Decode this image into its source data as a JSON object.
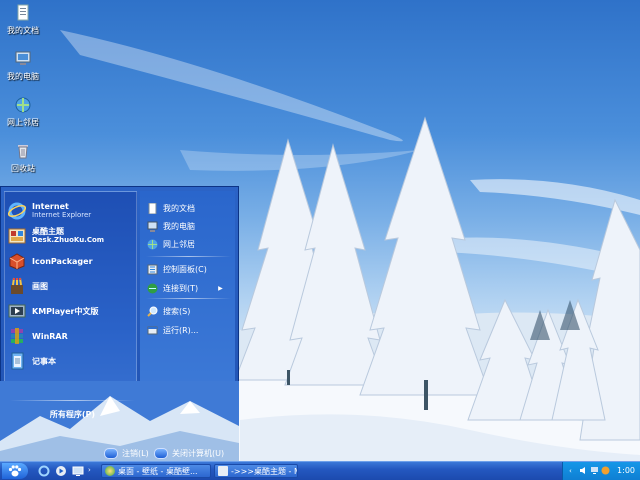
{
  "desktop": {
    "icons": [
      {
        "label": "我的文档",
        "icon": "my-documents-icon"
      },
      {
        "label": "我的电脑",
        "icon": "my-computer-icon"
      },
      {
        "label": "网上邻居",
        "icon": "network-places-icon"
      },
      {
        "label": "回收站",
        "icon": "recycle-bin-icon"
      }
    ]
  },
  "start_menu": {
    "programs": [
      {
        "name": "Internet",
        "sub": "Internet Explorer",
        "icon": "internet-explorer-icon"
      },
      {
        "name": "桌酷主题",
        "sub": "Desk.ZhuoKu.Com",
        "icon": "zhuoku-theme-icon"
      },
      {
        "name": "IconPackager",
        "sub": "",
        "icon": "iconpackager-icon"
      },
      {
        "name": "画图",
        "sub": "",
        "icon": "paint-icon"
      },
      {
        "name": "KMPlayer中文版",
        "sub": "",
        "icon": "kmplayer-icon"
      },
      {
        "name": "WinRAR",
        "sub": "",
        "icon": "winrar-icon"
      },
      {
        "name": "记事本",
        "sub": "",
        "icon": "notepad-icon"
      }
    ],
    "all_programs": "所有程序(P)",
    "places": [
      {
        "label": "我的文档",
        "icon": "my-documents-icon"
      },
      {
        "label": "我的电脑",
        "icon": "my-computer-icon"
      },
      {
        "label": "网上邻居",
        "icon": "network-places-icon"
      },
      {
        "label": "控制面板(C)",
        "icon": "control-panel-icon"
      },
      {
        "label": "连接到(T)",
        "icon": "connect-to-icon"
      },
      {
        "label": "搜索(S)",
        "icon": "search-icon"
      },
      {
        "label": "运行(R)...",
        "icon": "run-icon"
      }
    ],
    "logoff": "注销(L)",
    "shutdown": "关闭计算机(U)"
  },
  "taskbar": {
    "tasks": [
      {
        "label": "桌面 - 壁纸 - 桌酷壁..."
      },
      {
        "label": "->>>桌酷主题 - Mic..."
      }
    ],
    "clock": "1:00"
  },
  "colors": {
    "taskbar": "#2458c0",
    "tray": "#1597e8",
    "start_menu": "#2b63c6"
  }
}
